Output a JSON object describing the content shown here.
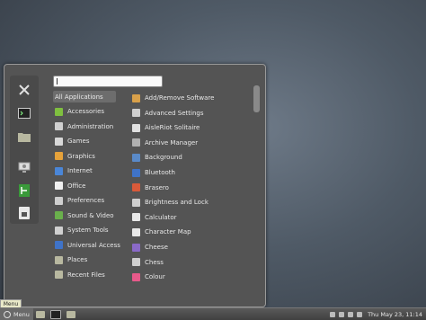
{
  "search": {
    "value": "",
    "placeholder": ""
  },
  "favorites": [
    {
      "icon": "tools-icon"
    },
    {
      "icon": "terminal-icon"
    },
    {
      "icon": "folder-icon"
    },
    {
      "icon": "monitor-settings-icon"
    },
    {
      "icon": "exit-icon"
    },
    {
      "icon": "lock-icon"
    }
  ],
  "categories": [
    {
      "label": "All Applications",
      "icon": "",
      "color": ""
    },
    {
      "label": "Accessories",
      "icon": "accessories-icon",
      "color": "#7fbf3f"
    },
    {
      "label": "Administration",
      "icon": "administration-icon",
      "color": "#cfcfcf"
    },
    {
      "label": "Games",
      "icon": "games-icon",
      "color": "#d8d8d8"
    },
    {
      "label": "Graphics",
      "icon": "graphics-icon",
      "color": "#e6a23a"
    },
    {
      "label": "Internet",
      "icon": "internet-icon",
      "color": "#4a86d8"
    },
    {
      "label": "Office",
      "icon": "office-icon",
      "color": "#f0f0f0"
    },
    {
      "label": "Preferences",
      "icon": "preferences-icon",
      "color": "#cfcfcf"
    },
    {
      "label": "Sound & Video",
      "icon": "sound-video-icon",
      "color": "#6ab04c"
    },
    {
      "label": "System Tools",
      "icon": "system-tools-icon",
      "color": "#d0d0d0"
    },
    {
      "label": "Universal Access",
      "icon": "universal-access-icon",
      "color": "#3f73c8"
    },
    {
      "label": "Places",
      "icon": "places-icon",
      "color": "#b8b8a0"
    },
    {
      "label": "Recent Files",
      "icon": "recent-files-icon",
      "color": "#b8b8a0"
    }
  ],
  "apps": [
    {
      "label": "Add/Remove Software",
      "icon": "package-icon",
      "color": "#d8a04a"
    },
    {
      "label": "Advanced Settings",
      "icon": "advanced-settings-icon",
      "color": "#cfcfcf"
    },
    {
      "label": "AisleRiot Solitaire",
      "icon": "solitaire-icon",
      "color": "#e0e0e0"
    },
    {
      "label": "Archive Manager",
      "icon": "archive-icon",
      "color": "#b0b0b0"
    },
    {
      "label": "Background",
      "icon": "background-icon",
      "color": "#5a8ac8"
    },
    {
      "label": "Bluetooth",
      "icon": "bluetooth-icon",
      "color": "#3f73c8"
    },
    {
      "label": "Brasero",
      "icon": "brasero-icon",
      "color": "#d85a3a"
    },
    {
      "label": "Brightness and Lock",
      "icon": "brightness-icon",
      "color": "#cfcfcf"
    },
    {
      "label": "Calculator",
      "icon": "calculator-icon",
      "color": "#e8e8e8"
    },
    {
      "label": "Character Map",
      "icon": "character-map-icon",
      "color": "#e8e8e8"
    },
    {
      "label": "Cheese",
      "icon": "cheese-icon",
      "color": "#8a6ac8"
    },
    {
      "label": "Chess",
      "icon": "chess-icon",
      "color": "#cfcfcf"
    },
    {
      "label": "Colour",
      "icon": "colour-icon",
      "color": "#e85a8a"
    }
  ],
  "taskbar": {
    "menu_label": "Menu",
    "tooltip": "Menu",
    "clock": "Thu May 23, 11:14"
  }
}
